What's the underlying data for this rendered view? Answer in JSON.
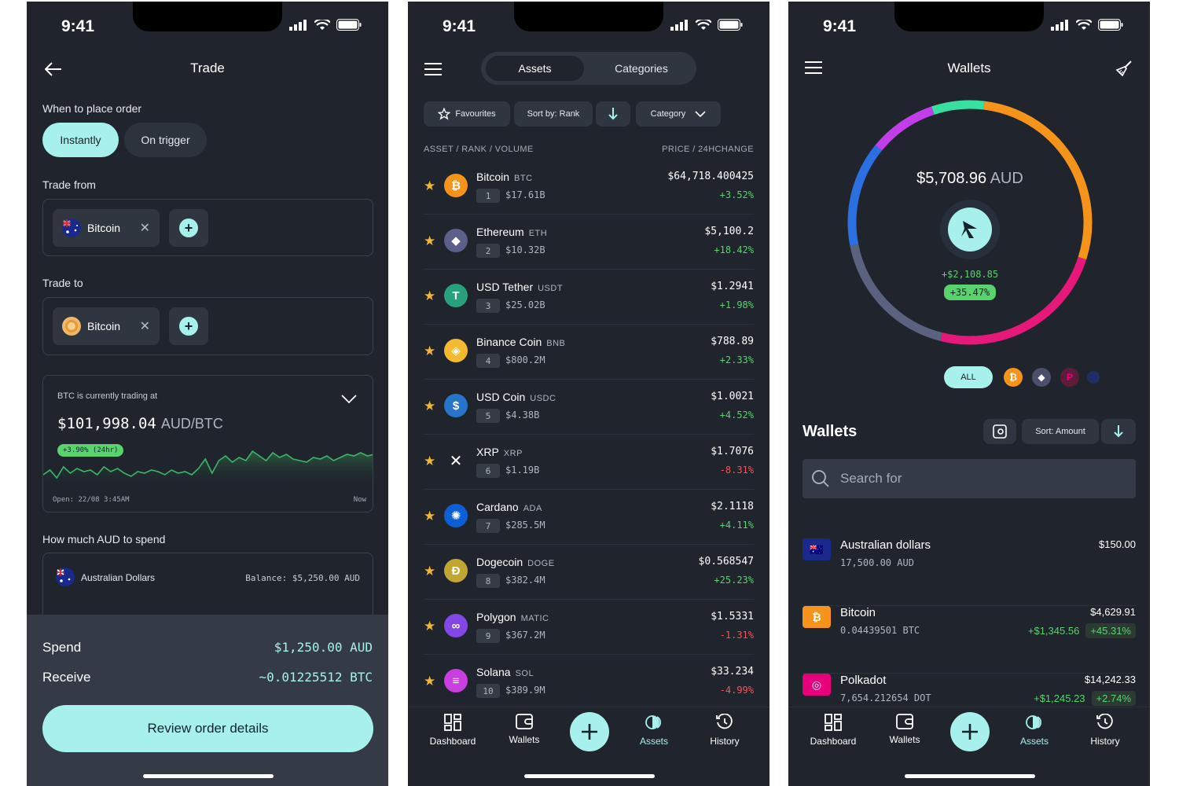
{
  "status": {
    "time": "9:41"
  },
  "trade": {
    "title": "Trade",
    "when_label": "When to place order",
    "when_options": [
      "Instantly",
      "On trigger"
    ],
    "from_label": "Trade from",
    "from_asset": "Bitcoin",
    "to_label": "Trade to",
    "to_asset": "Bitcoin",
    "price_card": {
      "caption": "BTC is currently trading at",
      "price": "$101,998.04",
      "unit": "AUD/BTC",
      "change": "+3.90% (24hr)",
      "open_label": "Open: 22/08 3:45AM",
      "now_label": "Now",
      "spark": [
        44,
        38,
        48,
        34,
        42,
        36,
        40,
        38,
        44,
        34,
        40,
        36,
        42,
        46,
        40,
        42,
        38,
        40,
        44,
        38,
        42,
        40,
        44,
        36,
        24,
        42,
        26,
        20,
        28,
        22,
        26,
        14,
        20,
        26,
        16,
        22,
        18,
        24,
        26,
        28,
        22,
        24,
        20,
        26,
        22,
        18,
        20,
        16,
        20,
        18
      ]
    },
    "spend_label": "How much AUD to spend",
    "spend_account": "Australian Dollars",
    "balance": "Balance: $5,250.00 AUD",
    "spend_row_label": "Spend",
    "spend_value": "$1,250.00 AUD",
    "receive_row_label": "Receive",
    "receive_value": "~0.01225512 BTC",
    "review_button": "Review order details"
  },
  "assets": {
    "tabs": [
      "Assets",
      "Categories"
    ],
    "filters": {
      "favourites": "Favourites",
      "sort": "Sort by: Rank",
      "category": "Category"
    },
    "col_left": "ASSET / RANK / VOLUME",
    "col_right": "PRICE / 24HCHANGE",
    "rows": [
      {
        "name": "Bitcoin",
        "sym": "BTC",
        "rank": "1",
        "vol": "$17.61B",
        "price": "$64,718.400425",
        "change": "+3.52%",
        "positive": true,
        "color": "#f7931a",
        "glyph": "₿"
      },
      {
        "name": "Ethereum",
        "sym": "ETH",
        "rank": "2",
        "vol": "$10.32B",
        "price": "$5,100.2",
        "change": "+18.42%",
        "positive": true,
        "color": "#5c5f8a",
        "glyph": "◆"
      },
      {
        "name": "USD Tether",
        "sym": "USDT",
        "rank": "3",
        "vol": "$25.02B",
        "price": "$1.2941",
        "change": "+1.98%",
        "positive": true,
        "color": "#26a17b",
        "glyph": "T"
      },
      {
        "name": "Binance Coin",
        "sym": "BNB",
        "rank": "4",
        "vol": "$800.2M",
        "price": "$788.89",
        "change": "+2.33%",
        "positive": true,
        "color": "#f3ba2f",
        "glyph": "◈"
      },
      {
        "name": "USD Coin",
        "sym": "USDC",
        "rank": "5",
        "vol": "$4.38B",
        "price": "$1.0021",
        "change": "+4.52%",
        "positive": true,
        "color": "#2775ca",
        "glyph": "$"
      },
      {
        "name": "XRP",
        "sym": "XRP",
        "rank": "6",
        "vol": "$1.19B",
        "price": "$1.7076",
        "change": "-8.31%",
        "positive": false,
        "color": "#1f242d",
        "glyph": "✕"
      },
      {
        "name": "Cardano",
        "sym": "ADA",
        "rank": "7",
        "vol": "$285.5M",
        "price": "$2.1118",
        "change": "+4.11%",
        "positive": true,
        "color": "#0d5fd6",
        "glyph": "✺"
      },
      {
        "name": "Dogecoin",
        "sym": "DOGE",
        "rank": "8",
        "vol": "$382.4M",
        "price": "$0.568547",
        "change": "+25.23%",
        "positive": true,
        "color": "#c2a633",
        "glyph": "Ð"
      },
      {
        "name": "Polygon",
        "sym": "MATIC",
        "rank": "9",
        "vol": "$367.2M",
        "price": "$1.5331",
        "change": "-1.31%",
        "positive": false,
        "color": "#8247e5",
        "glyph": "∞"
      },
      {
        "name": "Solana",
        "sym": "SOL",
        "rank": "10",
        "vol": "$389.9M",
        "price": "$33.234",
        "change": "-4.99%",
        "positive": false,
        "color": "#c93ee0",
        "glyph": "≡"
      }
    ]
  },
  "nav": {
    "dashboard": "Dashboard",
    "wallets": "Wallets",
    "assets": "Assets",
    "history": "History"
  },
  "wallets": {
    "title": "Wallets",
    "total": "$5,708.96",
    "currency": "AUD",
    "gain": "+$2,108.85",
    "gain_pct": "+35.47%",
    "filter_all": "ALL",
    "ring": [
      {
        "color": "#f6931a",
        "value": 28
      },
      {
        "color": "#e6197b",
        "value": 24
      },
      {
        "color": "#5b6280",
        "value": 18
      },
      {
        "color": "#2b6fe0",
        "value": 14
      },
      {
        "color": "#c13ee8",
        "value": 9
      },
      {
        "color": "#37e0a0",
        "value": 7
      }
    ],
    "section_title": "Wallets",
    "sort": "Sort: Amount",
    "search_placeholder": "Search for",
    "items": [
      {
        "name": "Australian dollars",
        "qty": "17,500.00 AUD",
        "value": "$150.00",
        "gain": "",
        "gain_pct": "",
        "color": "#1a2a8c",
        "glyph": "🇦🇺"
      },
      {
        "name": "Bitcoin",
        "qty": "0.04439501 BTC",
        "value": "$4,629.91",
        "gain": "+$1,345.56",
        "gain_pct": "+45.31%",
        "color": "#f6931a",
        "glyph": "₿"
      },
      {
        "name": "Polkadot",
        "qty": "7,654.212654 DOT",
        "value": "$14,242.33",
        "gain": "+$1,245.23",
        "gain_pct": "+2.74%",
        "color": "#e6007a",
        "glyph": "◎"
      }
    ]
  }
}
